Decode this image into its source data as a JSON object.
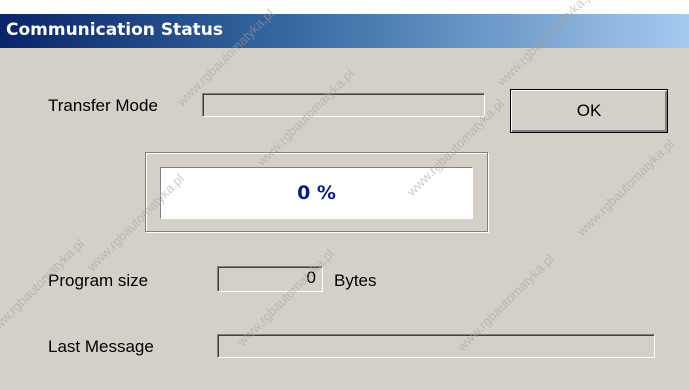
{
  "window": {
    "title": "Communication Status"
  },
  "fields": {
    "transfer_mode_label": "Transfer Mode",
    "transfer_mode_value": "",
    "program_size_label": "Program size",
    "program_size_value": "0",
    "program_size_unit": "Bytes",
    "last_message_label": "Last Message",
    "last_message_value": ""
  },
  "buttons": {
    "ok_label": "OK"
  },
  "progress": {
    "text": "0 %",
    "fraction": 0
  },
  "watermark": {
    "text": "www.rgbautomatyka.pl"
  },
  "colors": {
    "titlebar_start": "#0a246a",
    "titlebar_end": "#a6caf0",
    "dialog_bg": "#d4d0c8",
    "progress_text": "#0a1a8c"
  }
}
